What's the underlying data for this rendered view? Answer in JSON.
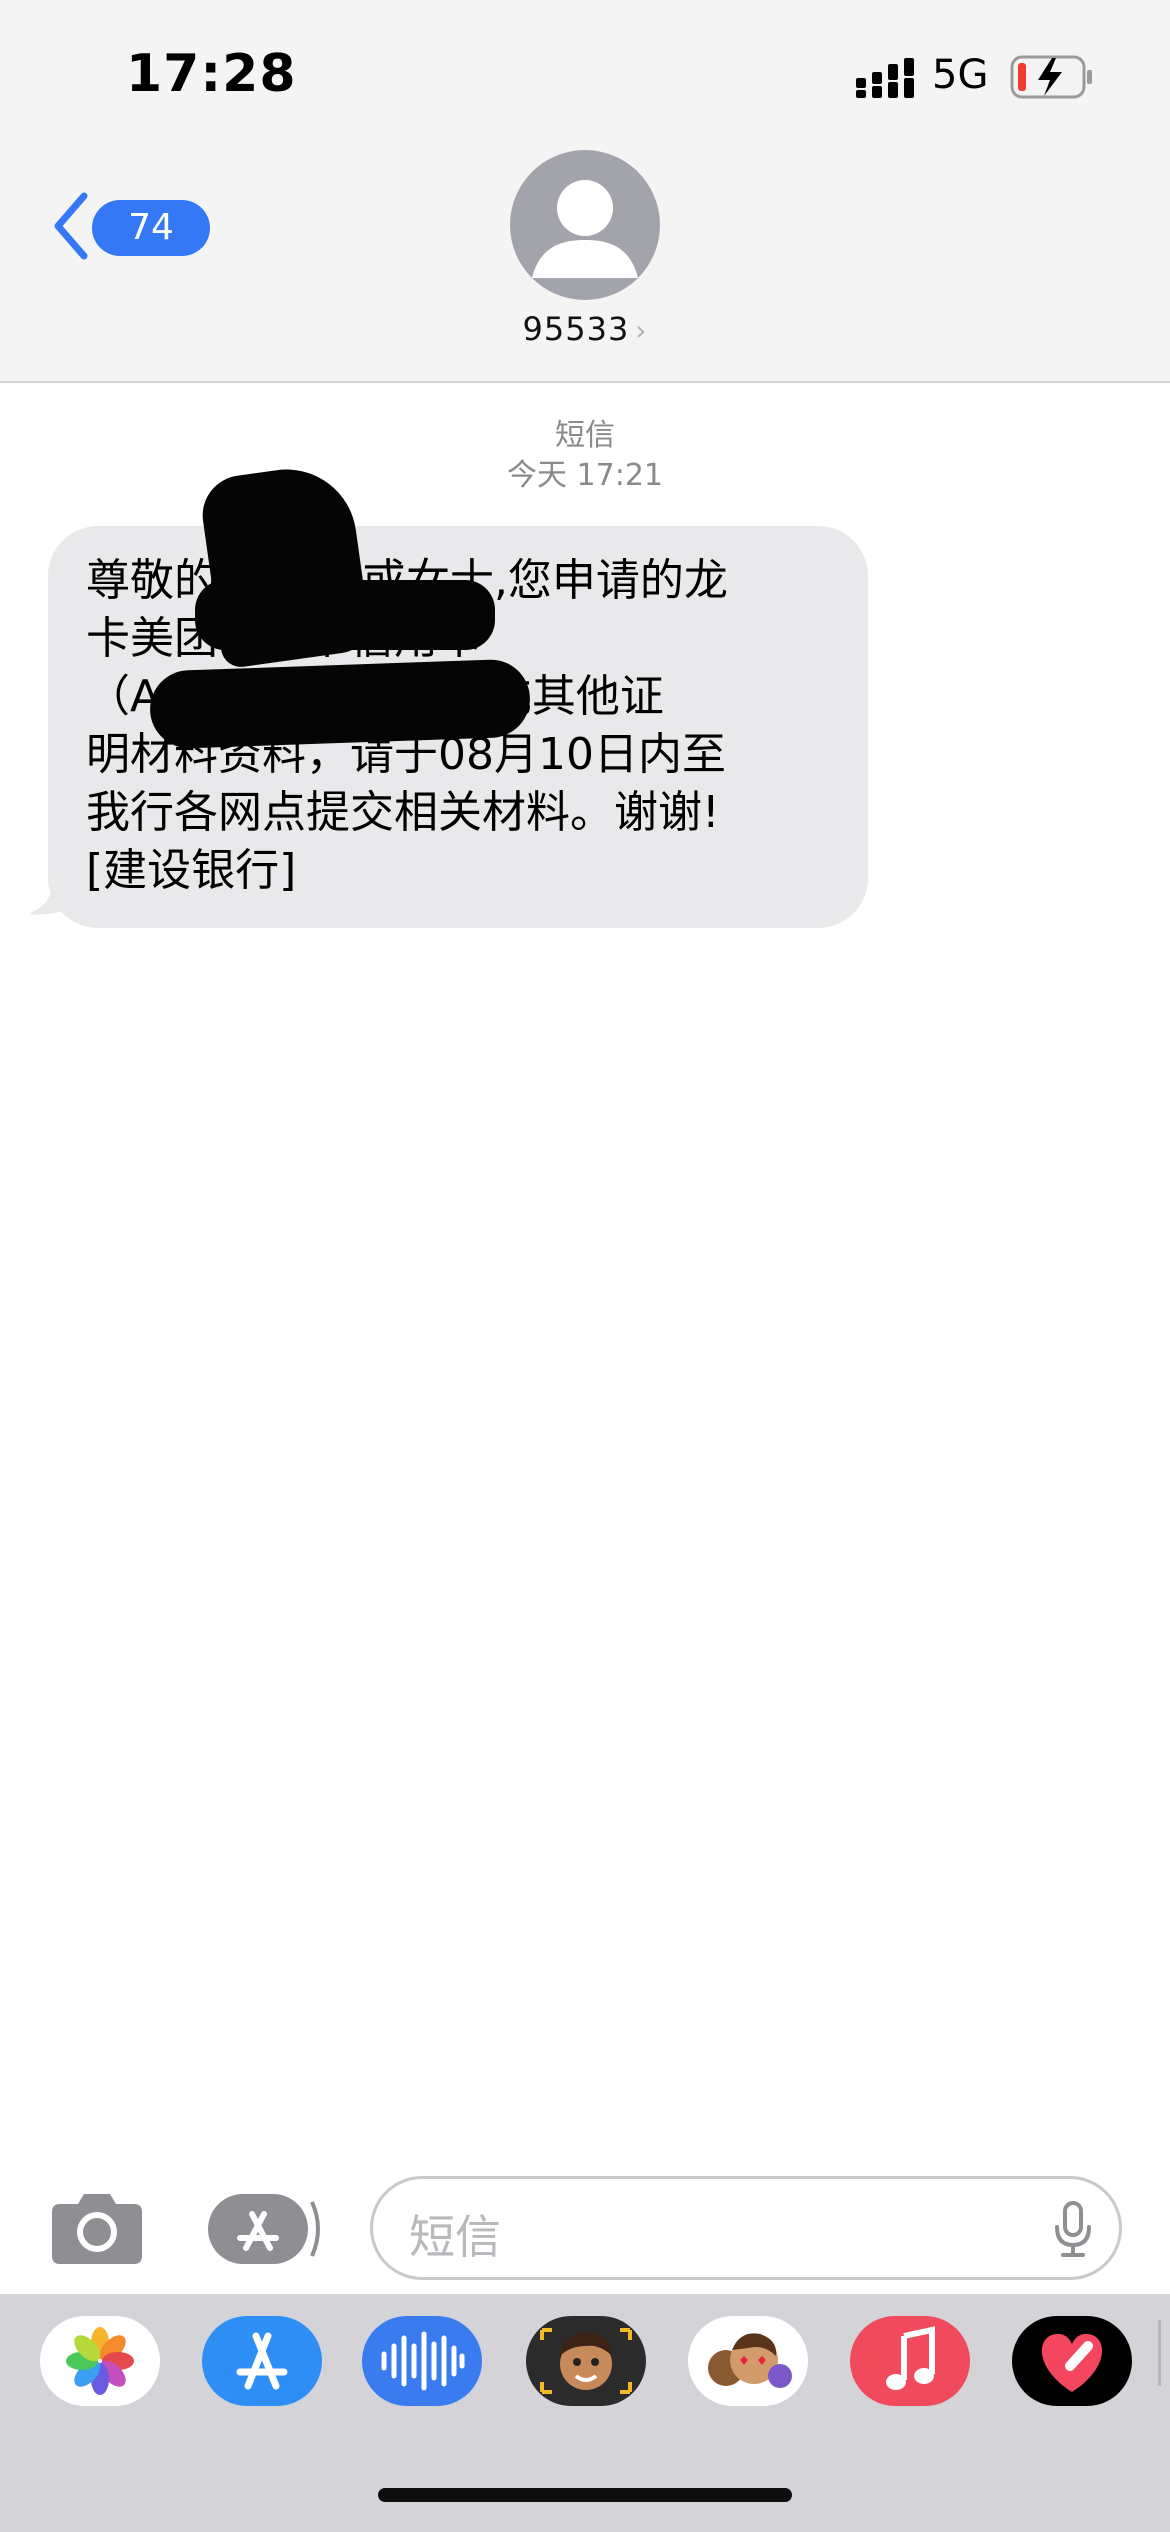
{
  "status_bar": {
    "time": "17:28",
    "network": "5G",
    "battery_state": "low-charging"
  },
  "header": {
    "back_badge": "74",
    "contact_name": "95533",
    "contact_chevron": "›"
  },
  "thread": {
    "service_label": "短信",
    "timestamp": "今天 17:21",
    "message": "尊敬的    先生或女士,您申请的龙\n卡美团信用卡信用卡\n（A              ）需补充其他证\n明材料资料，请于08月10日内至\n我行各网点提交相关材料。谢谢!\n[建设银行]"
  },
  "composer": {
    "placeholder": "短信"
  },
  "app_drawer": {
    "apps": [
      "photos-app",
      "app-store-app",
      "audio-messages-app",
      "memoji-app",
      "animoji-stickers-app",
      "music-app",
      "digital-touch-app"
    ]
  },
  "colors": {
    "accent": "#3478f6",
    "bubble": "#e9e9eb",
    "music": "#f04a5c"
  }
}
